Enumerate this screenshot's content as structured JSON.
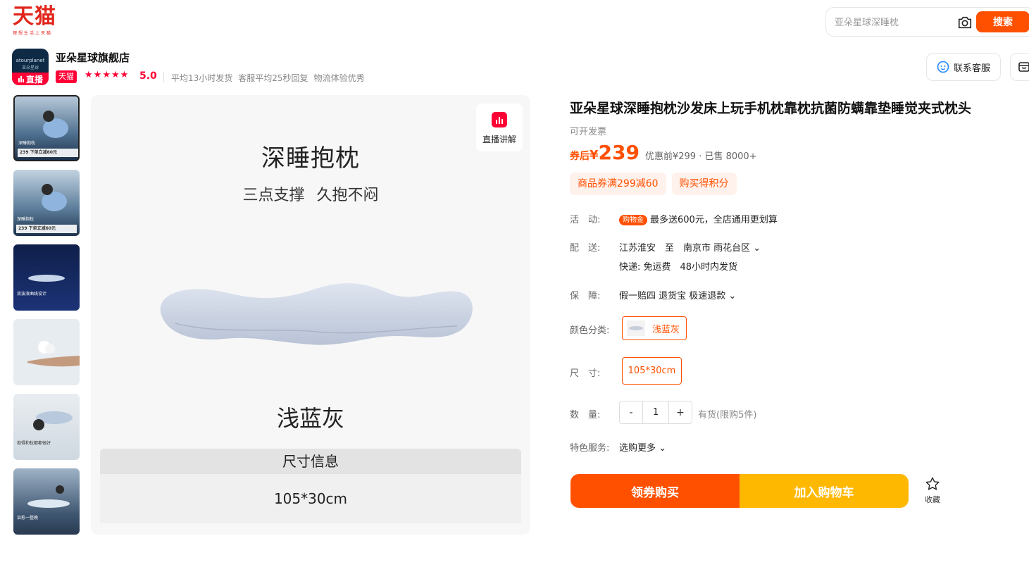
{
  "header": {
    "logo_text": "天猫",
    "logo_sub": "理想生活上天猫",
    "search_placeholder": "亚朵星球深睡枕",
    "search_button": "搜索"
  },
  "shop": {
    "avatar_brand": "atourplanet",
    "avatar_brand_cn": "亚朵星球",
    "live_label": "直播",
    "name": "亚朵星球旗舰店",
    "tmall_tag": "天猫",
    "stars": 5,
    "rating": "5.0",
    "meta": [
      "平均13小时发货",
      "客服平均25秒回复",
      "物流体验优秀"
    ],
    "service_button": "联系客服"
  },
  "thumbnails": [
    {
      "caption": "深睡抱枕",
      "price": "239 下单立减60元"
    },
    {
      "caption": "深睡抱枕",
      "price": "239 下单立减60元"
    },
    {
      "caption": "双波浪曲线设计",
      "price": ""
    },
    {
      "caption": "",
      "price": ""
    },
    {
      "caption": "抱得和枕都都很好",
      "price": ""
    },
    {
      "caption": "治愈一整晚",
      "price": ""
    }
  ],
  "main_image": {
    "title": "深睡抱枕",
    "subtitle": "三点支撑 久抱不闷",
    "color_name": "浅蓝灰",
    "size_header": "尺寸信息",
    "size_value": "105*30cm",
    "live_explain": "直播讲解"
  },
  "product": {
    "title": "亚朵星球深睡抱枕沙发床上玩手机枕靠枕抗菌防螨靠垫睡觉夹式枕头",
    "invoice": "可开发票",
    "coupon_label": "券后",
    "currency": "¥",
    "price": "239",
    "original": "优惠前¥299 · 已售 8000+",
    "tags": [
      "商品券满299减60",
      "购买得积分"
    ],
    "activity_label": "活　动:",
    "activity_badge": "购物金",
    "activity_text": "最多送600元，全店通用更划算",
    "delivery_label": "配　送:",
    "delivery_text": "江苏淮安　至　南京市 雨花台区",
    "delivery_sub": "快递: 免运费　48小时内发货",
    "guarantee_label": "保　障:",
    "guarantee_text": "假一赔四 退货宝 极速退款",
    "color_label": "颜色分类:",
    "color_option": "浅蓝灰",
    "size_label": "尺　寸:",
    "size_option": "105*30cm",
    "qty_label": "数　量:",
    "qty_minus": "-",
    "qty_value": "1",
    "qty_plus": "+",
    "stock": "有货(限购5件)",
    "special_label": "特色服务:",
    "special_text": "选购更多",
    "buy_button": "领券购买",
    "cart_button": "加入购物车",
    "fav_label": "收藏"
  },
  "colors": {
    "accent": "#ff5000",
    "tmall_red": "#ff0036",
    "cart_yellow": "#ffb800"
  }
}
